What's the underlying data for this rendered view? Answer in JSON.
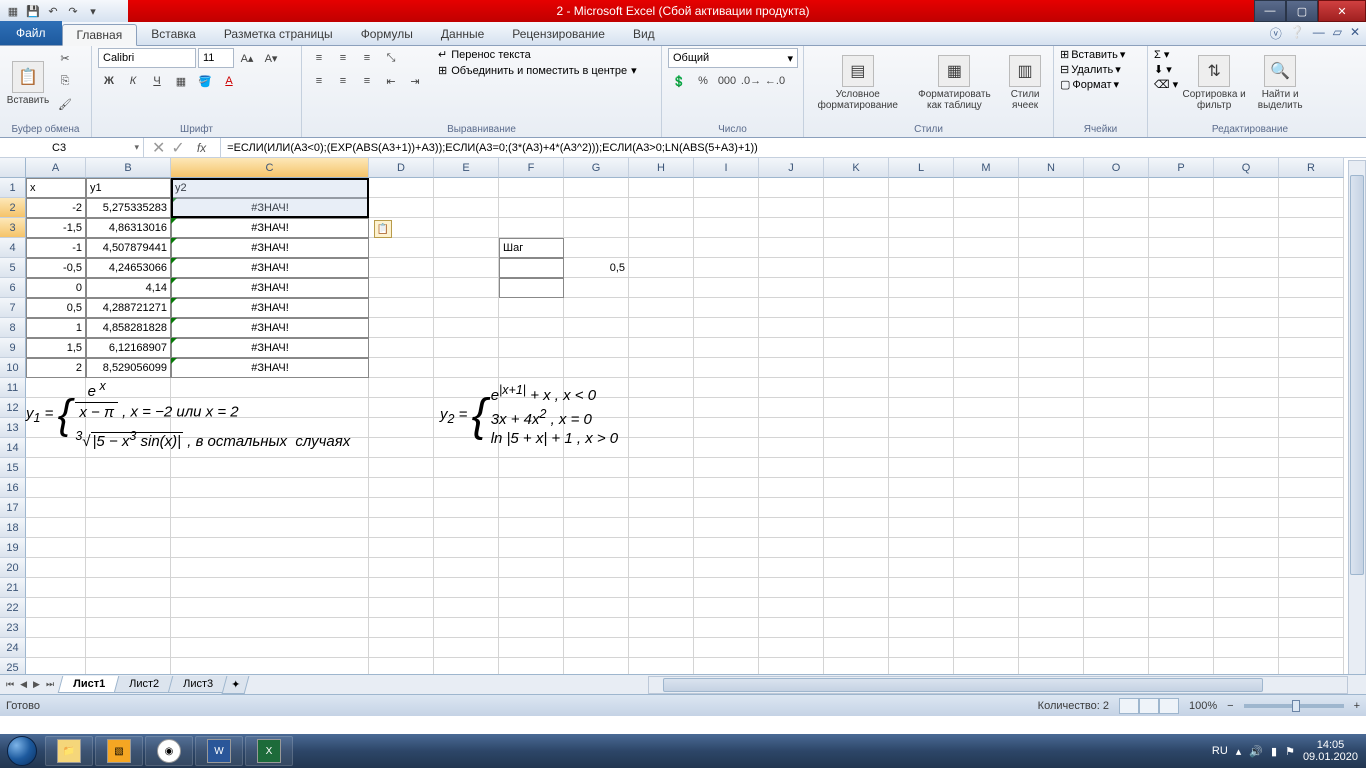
{
  "title": "2 - Microsoft Excel (Сбой активации продукта)",
  "tabs": {
    "file": "Файл",
    "items": [
      "Главная",
      "Вставка",
      "Разметка страницы",
      "Формулы",
      "Данные",
      "Рецензирование",
      "Вид"
    ],
    "active": 0
  },
  "ribbon": {
    "clipboard": {
      "label": "Буфер обмена",
      "paste": "Вставить"
    },
    "font": {
      "label": "Шрифт",
      "name": "Calibri",
      "size": "11"
    },
    "align": {
      "label": "Выравнивание",
      "wrap": "Перенос текста",
      "merge": "Объединить и поместить в центре"
    },
    "number": {
      "label": "Число",
      "format": "Общий"
    },
    "styles": {
      "label": "Стили",
      "cond": "Условное форматирование",
      "table": "Форматировать как таблицу",
      "cell": "Стили ячеек"
    },
    "cells": {
      "label": "Ячейки",
      "insert": "Вставить",
      "delete": "Удалить",
      "format": "Формат"
    },
    "editing": {
      "label": "Редактирование",
      "sort": "Сортировка и фильтр",
      "find": "Найти и выделить"
    }
  },
  "namebox": "C3",
  "formula": "=ЕСЛИ(ИЛИ(A3<0);(EXP(ABS(A3+1))+A3));ЕСЛИ(A3=0;(3*(A3)+4*(A3^2)));ЕСЛИ(A3>0;LN(ABS(5+A3)+1))",
  "columns": [
    "A",
    "B",
    "C",
    "D",
    "E",
    "F",
    "G",
    "H",
    "I",
    "J",
    "K",
    "L",
    "M",
    "N",
    "O",
    "P",
    "Q",
    "R"
  ],
  "col_widths": {
    "A": 60,
    "B": 85,
    "C": 198,
    "D": 65,
    "E": 65,
    "F": 65,
    "G": 65,
    "H": 65,
    "I": 65,
    "J": 65,
    "K": 65,
    "L": 65,
    "M": 65,
    "N": 65,
    "O": 65,
    "P": 65,
    "Q": 65,
    "R": 65
  },
  "headers": {
    "x": "x",
    "y1": "y1",
    "y2": "y2",
    "step": "Шаг"
  },
  "step_value": "0,5",
  "error": "#ЗНАЧ!",
  "grid": [
    {
      "x": "-2",
      "y1": "5,275335283"
    },
    {
      "x": "-1,5",
      "y1": "4,86313016"
    },
    {
      "x": "-1",
      "y1": "4,507879441"
    },
    {
      "x": "-0,5",
      "y1": "4,24653066"
    },
    {
      "x": "0",
      "y1": "4,14"
    },
    {
      "x": "0,5",
      "y1": "4,288721271"
    },
    {
      "x": "1",
      "y1": "4,858281828"
    },
    {
      "x": "1,5",
      "y1": "6,12168907"
    },
    {
      "x": "2",
      "y1": "8,529056099"
    }
  ],
  "sheets": {
    "items": [
      "Лист1",
      "Лист2",
      "Лист3"
    ],
    "active": 0
  },
  "status": {
    "ready": "Готово",
    "count_label": "Количество: 2",
    "zoom": "100%"
  },
  "taskbar": {
    "lang": "RU",
    "time": "14:05",
    "date": "09.01.2020"
  }
}
